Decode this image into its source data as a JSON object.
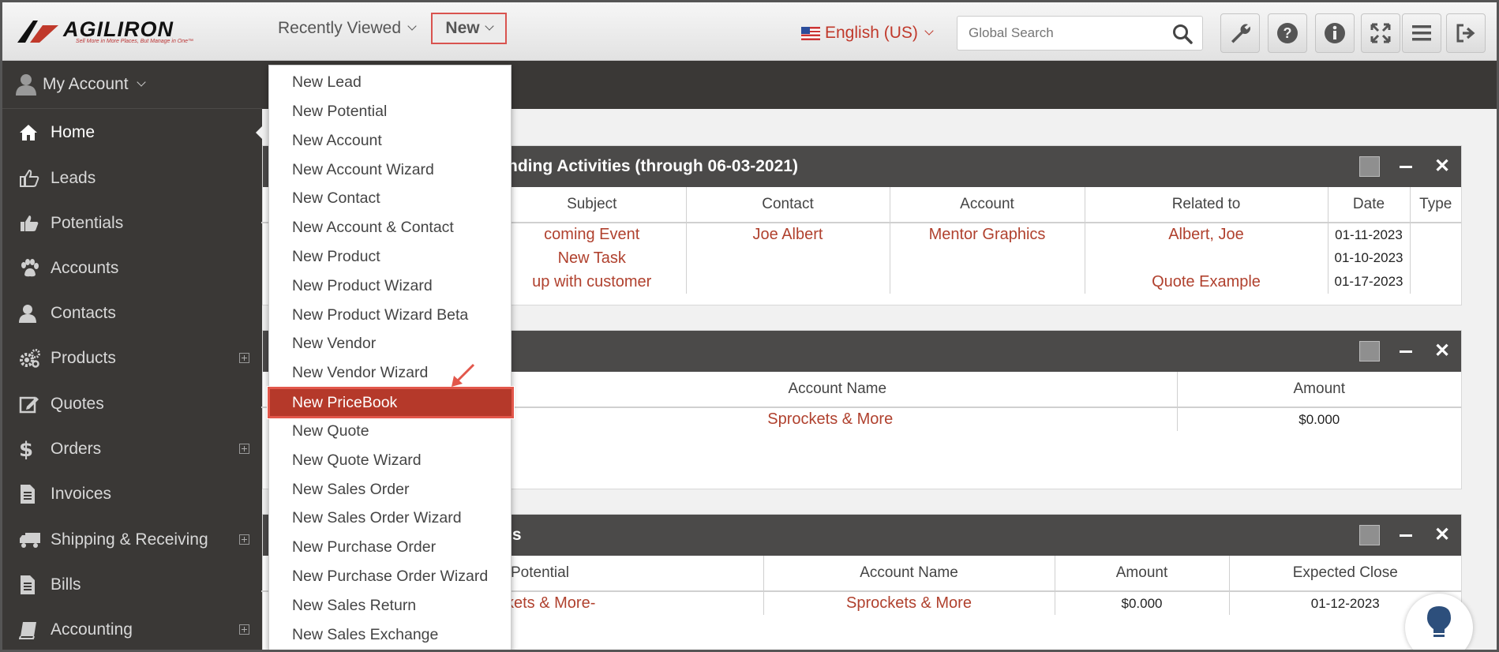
{
  "brand": {
    "name": "AGILIRON",
    "tagline": "Sell More in More Places, But Manage in One™"
  },
  "topbar": {
    "recently_viewed": "Recently Viewed",
    "new_label": "New",
    "language": "English (US)",
    "search_placeholder": "Global Search",
    "tools": [
      "wrench-icon",
      "help-icon",
      "info-icon",
      "fullscreen-icon",
      "menu-icon",
      "logout-icon"
    ]
  },
  "sidebar": {
    "account_label": "My Account",
    "items": [
      {
        "label": "Home",
        "icon": "home-icon",
        "active": true
      },
      {
        "label": "Leads",
        "icon": "thumbs-up-outline-icon"
      },
      {
        "label": "Potentials",
        "icon": "thumbs-up-icon"
      },
      {
        "label": "Accounts",
        "icon": "paw-icon"
      },
      {
        "label": "Contacts",
        "icon": "user-icon"
      },
      {
        "label": "Products",
        "icon": "gears-icon",
        "expandable": true
      },
      {
        "label": "Quotes",
        "icon": "edit-icon"
      },
      {
        "label": "Orders",
        "icon": "dollar-icon",
        "expandable": true
      },
      {
        "label": "Invoices",
        "icon": "document-icon"
      },
      {
        "label": "Shipping & Receiving",
        "icon": "truck-icon",
        "expandable": true
      },
      {
        "label": "Bills",
        "icon": "bills-icon"
      },
      {
        "label": "Accounting",
        "icon": "book-icon",
        "expandable": true
      }
    ]
  },
  "new_menu": {
    "items": [
      "New Lead",
      "New Potential",
      "New Account",
      "New Account Wizard",
      "New Contact",
      "New Account & Contact",
      "New Product",
      "New Product Wizard",
      "New Product Wizard Beta",
      "New Vendor",
      "New Vendor Wizard",
      "New PriceBook",
      "New Quote",
      "New Quote Wizard",
      "New Sales Order",
      "New Sales Order Wizard",
      "New Purchase Order",
      "New Purchase Order Wizard",
      "New Sales Return",
      "New Sales Exchange"
    ],
    "highlighted": "New PriceBook"
  },
  "activities_widget": {
    "title": "nding Activities (through 06-03-2021)",
    "columns": [
      "Subject",
      "Contact",
      "Account",
      "Related to",
      "Date",
      "Type"
    ],
    "rows": [
      {
        "subject": "coming Event",
        "contact": "Joe Albert",
        "account": "Mentor Graphics",
        "related": "Albert, Joe",
        "date": "01-11-2023",
        "type": ""
      },
      {
        "subject": "New Task",
        "contact": "",
        "account": "",
        "related": "",
        "date": "01-10-2023",
        "type": ""
      },
      {
        "subject": "up with customer",
        "contact": "",
        "account": "",
        "related": "Quote Example",
        "date": "01-17-2023",
        "type": ""
      }
    ]
  },
  "accounts_widget": {
    "title": "",
    "columns": [
      "Account Name",
      "Amount"
    ],
    "rows": [
      {
        "account": "Sprockets & More",
        "amount": "$0.000"
      }
    ]
  },
  "potentials_widget": {
    "title": "ls",
    "columns": [
      "Potential",
      "Account Name",
      "Amount",
      "Expected Close"
    ],
    "rows": [
      {
        "potential": "kets & More-",
        "account": "Sprockets & More",
        "amount": "$0.000",
        "close": "01-12-2023"
      }
    ]
  }
}
